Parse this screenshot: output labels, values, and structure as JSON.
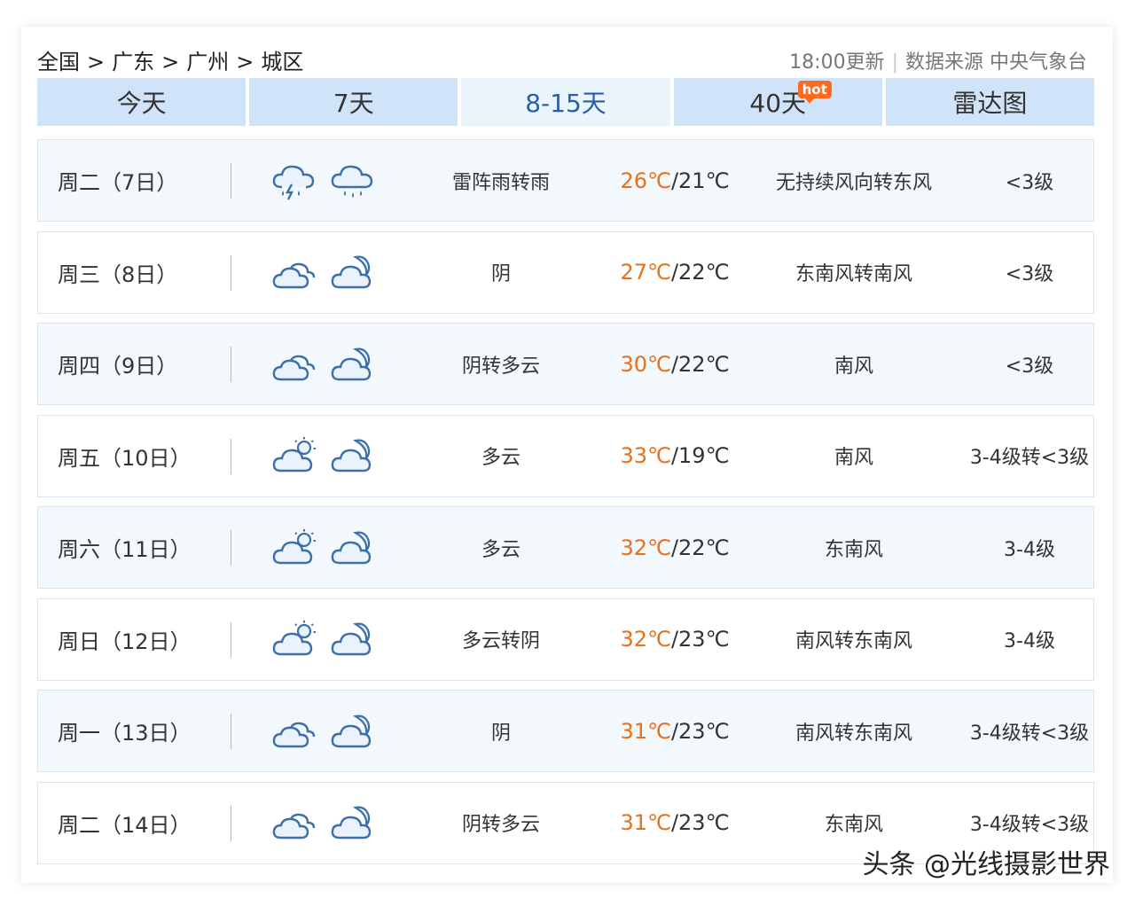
{
  "breadcrumb": [
    "全国",
    "广东",
    "广州",
    "城区"
  ],
  "breadcrumb_sep": ">",
  "meta": {
    "updated": "18:00更新",
    "source": "数据来源 中央气象台"
  },
  "tabs": [
    {
      "label": "今天",
      "active": false
    },
    {
      "label": "7天",
      "active": false
    },
    {
      "label": "8-15天",
      "active": true
    },
    {
      "label": "40天",
      "active": false,
      "badge": "hot"
    },
    {
      "label": "雷达图",
      "active": false
    }
  ],
  "forecast": [
    {
      "day": "周二（7日）",
      "icons": [
        "thunder-rain-cloud-icon",
        "rain-cloud-icon"
      ],
      "desc": "雷阵雨转雨",
      "hi": "26℃",
      "lo": "/21℃",
      "wind": "无持续风向转东风",
      "level": "<3级"
    },
    {
      "day": "周三（8日）",
      "icons": [
        "overcast-icon",
        "cloudy-night-icon"
      ],
      "desc": "阴",
      "hi": "27℃",
      "lo": "/22℃",
      "wind": "东南风转南风",
      "level": "<3级"
    },
    {
      "day": "周四（9日）",
      "icons": [
        "overcast-icon",
        "cloudy-night-icon"
      ],
      "desc": "阴转多云",
      "hi": "30℃",
      "lo": "/22℃",
      "wind": "南风",
      "level": "<3级"
    },
    {
      "day": "周五（10日）",
      "icons": [
        "partly-cloudy-day-icon",
        "cloudy-night-icon"
      ],
      "desc": "多云",
      "hi": "33℃",
      "lo": "/19℃",
      "wind": "南风",
      "level": "3-4级转<3级"
    },
    {
      "day": "周六（11日）",
      "icons": [
        "partly-cloudy-day-icon",
        "cloudy-night-icon"
      ],
      "desc": "多云",
      "hi": "32℃",
      "lo": "/22℃",
      "wind": "东南风",
      "level": "3-4级"
    },
    {
      "day": "周日（12日）",
      "icons": [
        "partly-cloudy-day-icon",
        "cloudy-night-icon"
      ],
      "desc": "多云转阴",
      "hi": "32℃",
      "lo": "/23℃",
      "wind": "南风转东南风",
      "level": "3-4级"
    },
    {
      "day": "周一（13日）",
      "icons": [
        "overcast-icon",
        "cloudy-night-icon"
      ],
      "desc": "阴",
      "hi": "31℃",
      "lo": "/23℃",
      "wind": "南风转东南风",
      "level": "3-4级转<3级"
    },
    {
      "day": "周二（14日）",
      "icons": [
        "overcast-icon",
        "cloudy-night-icon"
      ],
      "desc": "阴转多云",
      "hi": "31℃",
      "lo": "/23℃",
      "wind": "东南风",
      "level": "3-4级转<3级"
    }
  ],
  "watermark": "头条 @光线摄影世界",
  "colors": {
    "tab_bg": "#cfe4f8",
    "tab_active_bg": "#eaf4fd",
    "tab_active_text": "#2a5ea8",
    "temp_hi": "#e8701a",
    "row_alt_bg": "#f3f8fd",
    "icon_stroke": "#3d6fa8",
    "hot_badge": "#ff6a1f"
  }
}
